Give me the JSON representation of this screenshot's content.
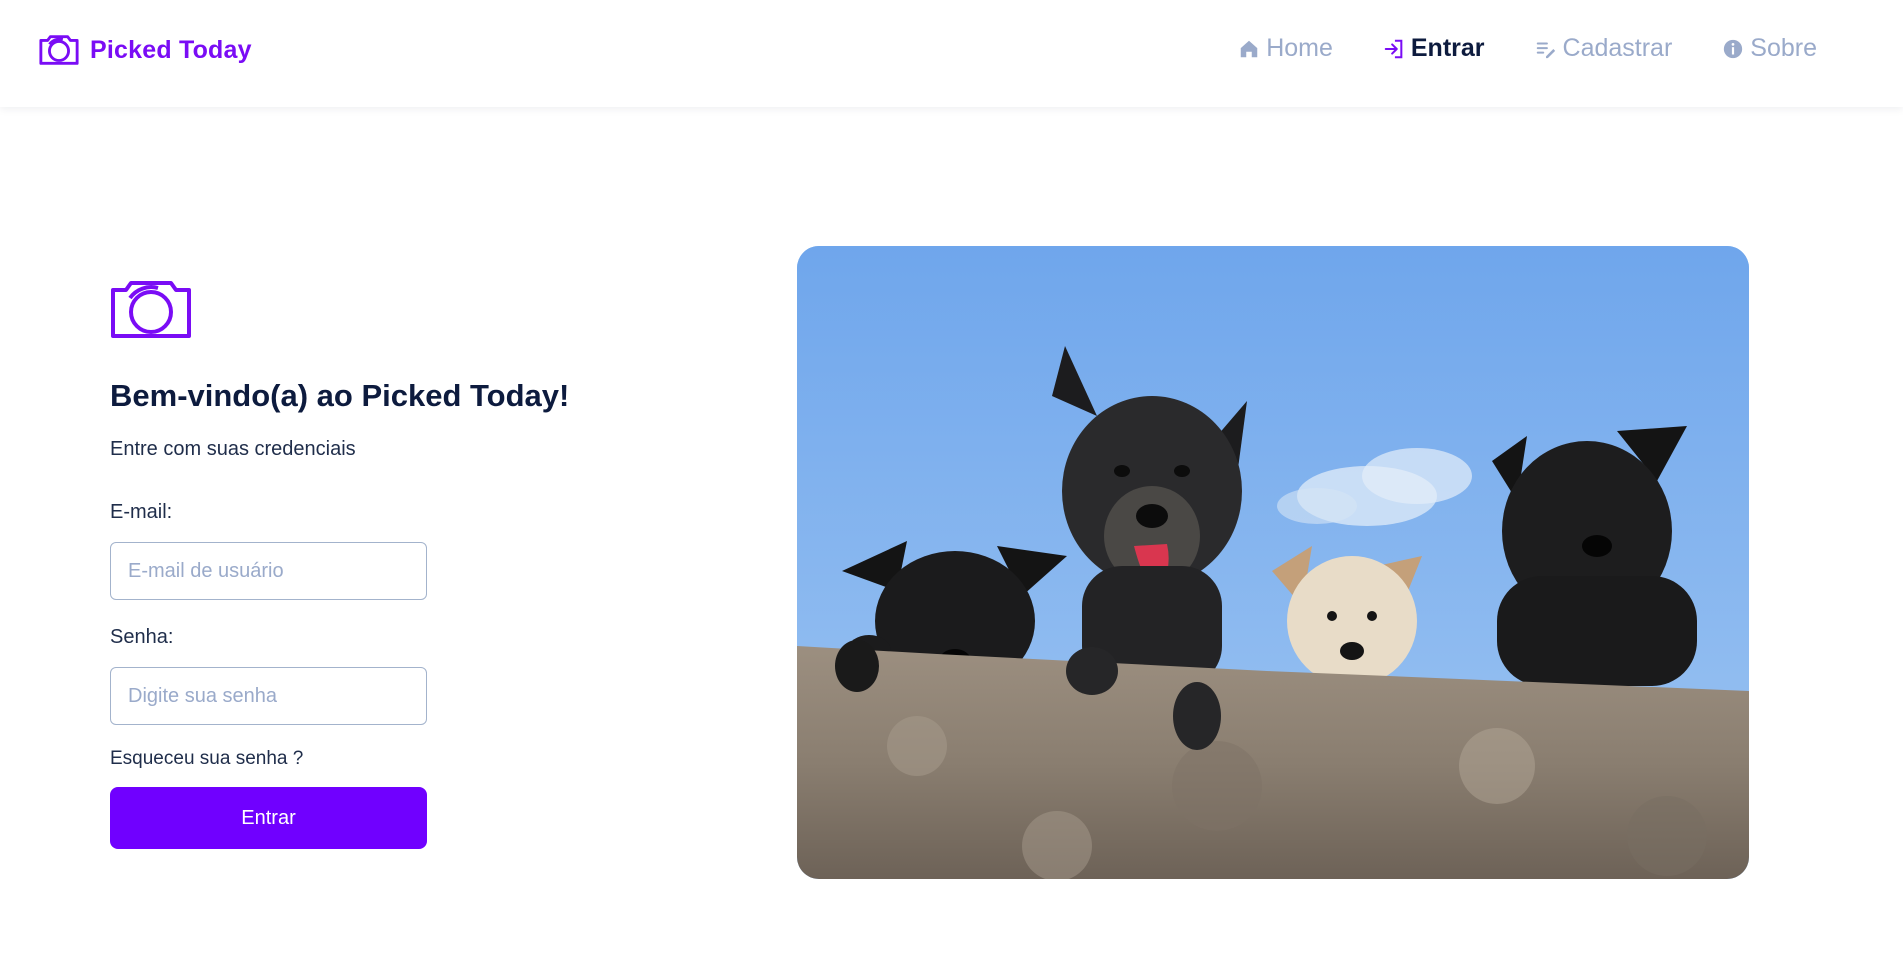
{
  "header": {
    "brand_name": "Picked Today",
    "brand_icon": "camera-icon"
  },
  "nav": {
    "items": [
      {
        "label": "Home",
        "icon": "home-icon",
        "active": false
      },
      {
        "label": "Entrar",
        "icon": "login-icon",
        "active": true
      },
      {
        "label": "Cadastrar",
        "icon": "register-icon",
        "active": false
      },
      {
        "label": "Sobre",
        "icon": "info-icon",
        "active": false
      }
    ]
  },
  "login": {
    "logo_icon": "camera-icon",
    "title": "Bem-vindo(a) ao Picked Today!",
    "subtitle": "Entre com suas credenciais",
    "email_label": "E-mail:",
    "email_placeholder": "E-mail de usuário",
    "email_value": "",
    "password_label": "Senha:",
    "password_placeholder": "Digite sua senha",
    "password_value": "",
    "forgot_link": "Esqueceu sua senha ?",
    "submit_label": "Entrar"
  },
  "hero": {
    "image": "four-dogs-over-wall-photo"
  },
  "colors": {
    "brand": "#7a0cf5",
    "button": "#7000ff",
    "nav_inactive": "#9aaaca",
    "text_dark": "#0d1b3e"
  }
}
